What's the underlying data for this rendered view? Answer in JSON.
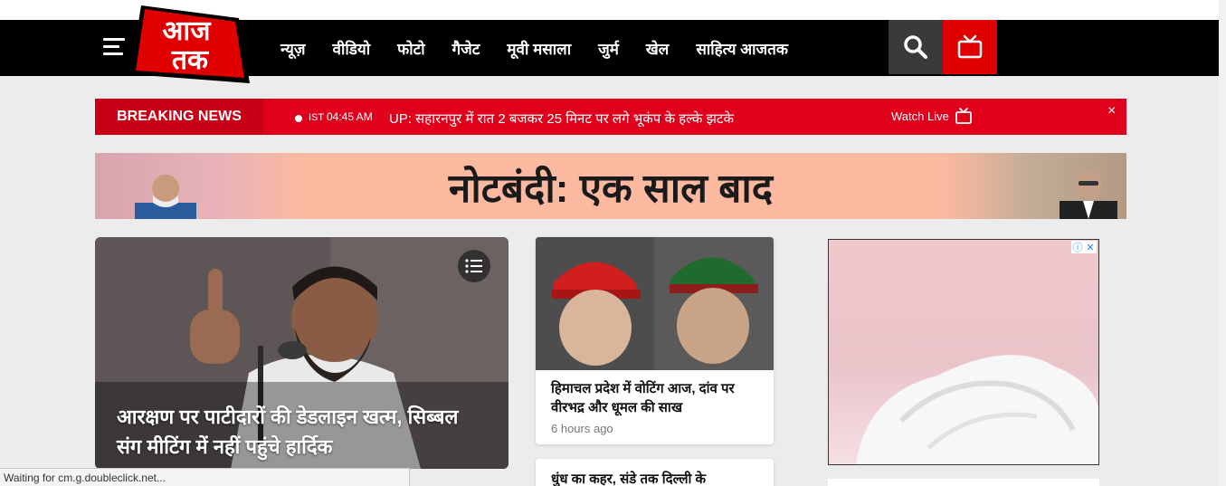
{
  "nav": {
    "logo_text": "आज तक",
    "items": [
      "न्यूज़",
      "वीडियो",
      "फोटो",
      "गैजेट",
      "मूवी मसाला",
      "जुर्म",
      "खेल",
      "साहित्य आजतक"
    ],
    "colors": {
      "bar": "#000000",
      "accent": "#e00000",
      "search_bg": "#3a3a3a"
    },
    "icons": [
      "hamburger-icon",
      "search-icon",
      "tv-icon"
    ]
  },
  "breaking": {
    "label": "BREAKING NEWS",
    "timezone": "IST",
    "time": "04:45 AM",
    "text": "UP: सहारनपुर में रात 2 बजकर 25 मिनट पर लगे भूकंप के हल्के झटके",
    "watch_live": "Watch Live",
    "close": "×"
  },
  "banner": {
    "text": "नोटबंदी: एक साल बाद"
  },
  "hero": {
    "title": "आरक्षण पर पाटीदारों की डेडलाइन खत्म, सिब्बल संग मीटिंग में नहीं पहुंचे हार्दिक"
  },
  "stories": [
    {
      "title": "हिमाचल प्रदेश में वोटिंग आज, दांव पर वीरभद्र और धूमल की साख",
      "time": "6 hours ago"
    },
    {
      "title": "धुंध का कहर, संडे तक दिल्ली के"
    }
  ],
  "ad": {
    "info_icon": "ⓘ",
    "close_icon": "✕"
  },
  "status_bar": {
    "text": "Waiting for cm.g.doubleclick.net..."
  }
}
